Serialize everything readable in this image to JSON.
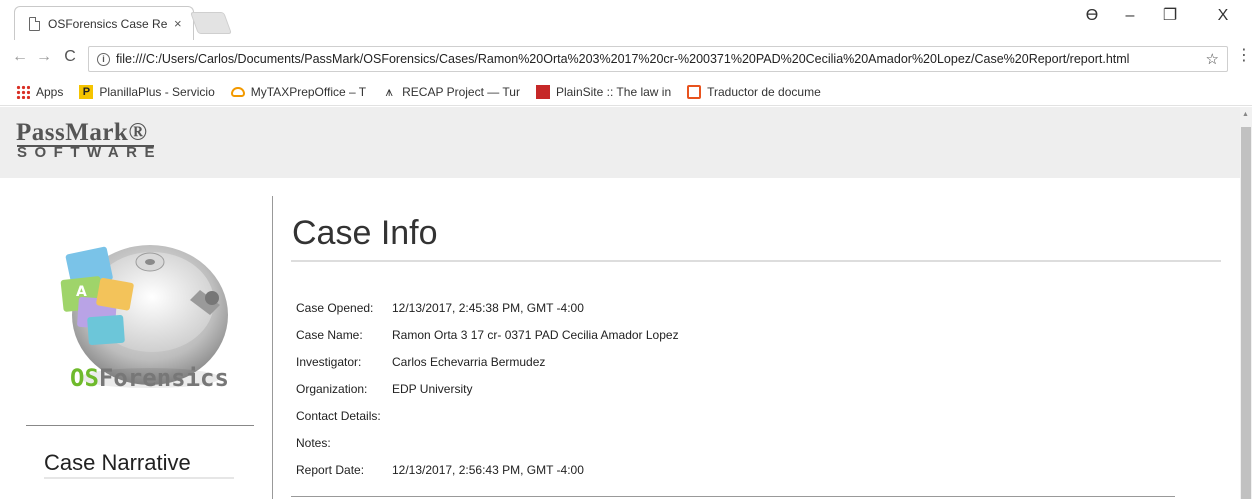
{
  "browser": {
    "tab_title": "OSForensics Case Report",
    "tab_close": "×",
    "url": "file:///C:/Users/Carlos/Documents/PassMark/OSForensics/Cases/Ramon%20Orta%203%2017%20cr-%200371%20PAD%20Cecilia%20Amador%20Lopez/Case%20Report/report.html",
    "window_controls": {
      "profile": "ϴ",
      "minimize": "–",
      "restore": "❐",
      "close": "X"
    },
    "nav": {
      "back": "←",
      "forward": "→",
      "reload": "C",
      "info": "i"
    },
    "star": "☆",
    "menu": "⋮"
  },
  "bookmarks": [
    {
      "label": "Apps",
      "icon": "apps-grid-icon"
    },
    {
      "label": "PlanillaPlus - Servicio",
      "icon": "planillaplus-icon"
    },
    {
      "label": "MyTAXPrepOffice – T",
      "icon": "cloud-icon"
    },
    {
      "label": "RECAP Project — Tur",
      "icon": "recap-icon"
    },
    {
      "label": "PlainSite :: The law in",
      "icon": "plainsite-icon"
    },
    {
      "label": "Traductor de docume",
      "icon": "translator-icon"
    }
  ],
  "header": {
    "logo_top": "PassMark®",
    "logo_bottom": "SOFTWARE"
  },
  "sidebar": {
    "product_os": "OS",
    "product_rest": "Forensics",
    "nav_item": "Case Narrative"
  },
  "main": {
    "title": "Case Info",
    "fields": [
      {
        "key": "Case Opened:",
        "value": "12/13/2017, 2:45:38 PM, GMT -4:00"
      },
      {
        "key": "Case Name:",
        "value": "Ramon Orta 3 17 cr- 0371 PAD Cecilia Amador Lopez"
      },
      {
        "key": "Investigator:",
        "value": "Carlos Echevarria Bermudez"
      },
      {
        "key": "Organization:",
        "value": "EDP University"
      },
      {
        "key": "Contact Details:",
        "value": ""
      },
      {
        "key": "Notes:",
        "value": ""
      },
      {
        "key": "Report Date:",
        "value": "12/13/2017, 2:56:43 PM, GMT -4:00"
      }
    ]
  },
  "colors": {
    "header_bg": "#eeeeee",
    "brand_green": "#6fba2c",
    "brand_gray": "#555555"
  }
}
